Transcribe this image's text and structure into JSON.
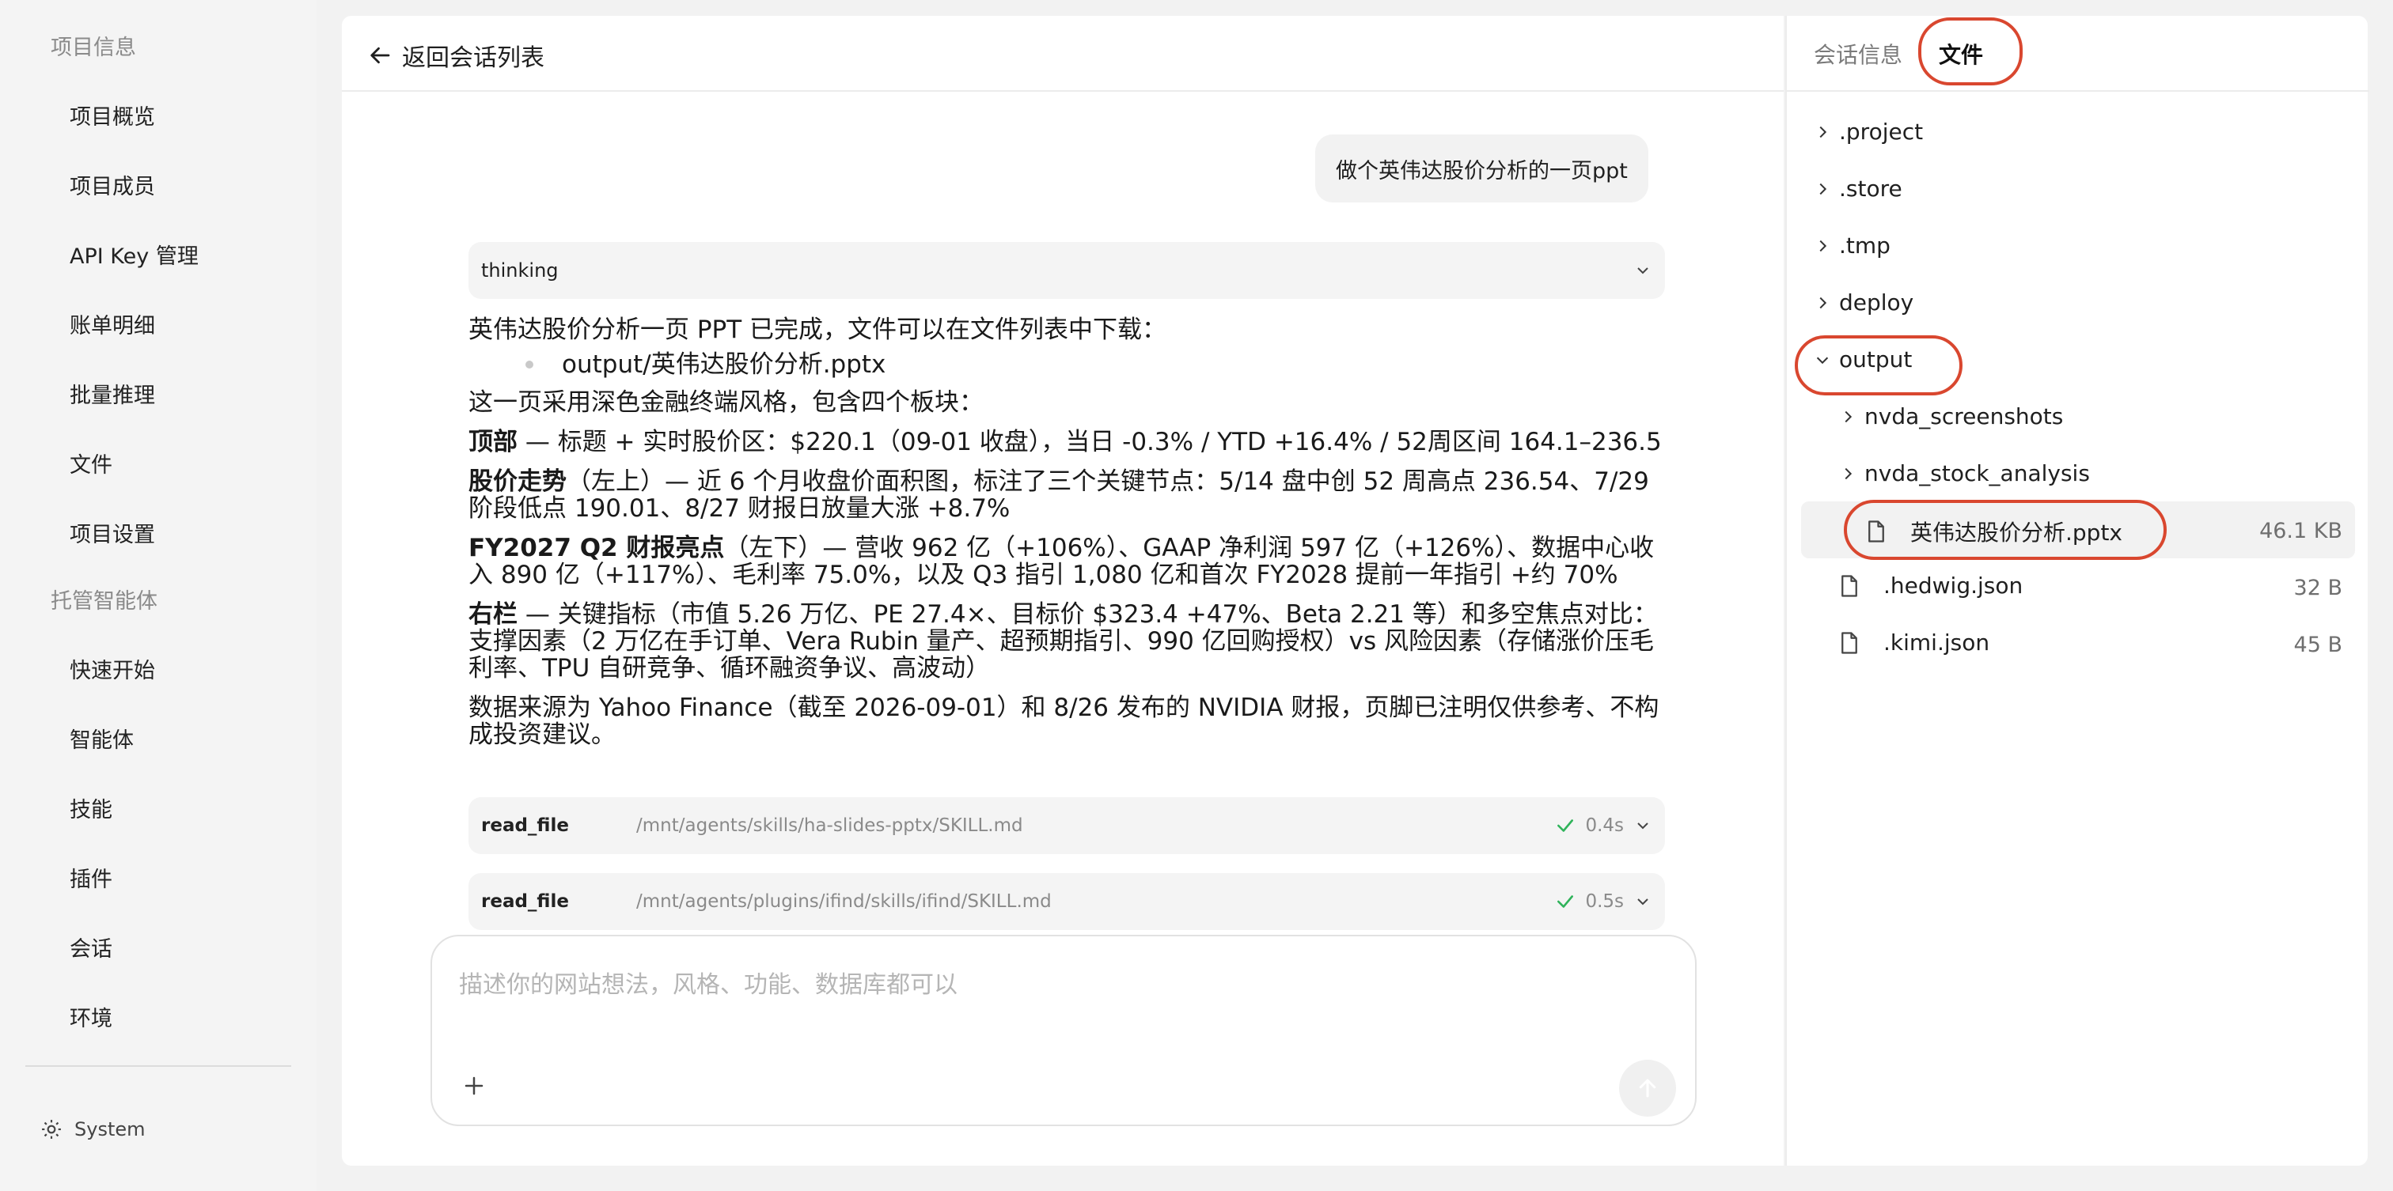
{
  "sidebar": {
    "group_project": "项目信息",
    "project_items": [
      "项目概览",
      "项目成员",
      "API Key 管理",
      "账单明细",
      "批量推理",
      "文件",
      "项目设置"
    ],
    "group_agents": "托管智能体",
    "agent_items": [
      "快速开始",
      "智能体",
      "技能",
      "插件",
      "会话",
      "环境"
    ],
    "system_label": "System"
  },
  "header": {
    "back_label": "返回会话列表"
  },
  "chat": {
    "user_message": "做个英伟达股价分析的一页ppt",
    "thinking_label": "thinking",
    "answer": {
      "intro": "英伟达股价分析一页 PPT 已完成，文件可以在文件列表中下载：",
      "file_bullet": "output/英伟达股价分析.pptx",
      "style_line": "这一页采用深色金融终端风格，包含四个板块：",
      "top_label": "顶部",
      "top_text": " — 标题 + 实时股价区：$220.1（09-01 收盘），当日 -0.3% / YTD +16.4% / 52周区间 164.1–236.5",
      "trend_label": "股价走势",
      "trend_text": "（左上）— 近 6 个月收盘价面积图，标注了三个关键节点：5/14 盘中创 52 周高点 236.54、7/29 阶段低点 190.01、8/27 财报日放量大涨 +8.7%",
      "fy_label": "FY2027 Q2 财报亮点",
      "fy_text": "（左下）— 营收 962 亿（+106%）、GAAP 净利润 597 亿（+126%）、数据中心收入 890 亿（+117%）、毛利率 75.0%，以及 Q3 指引 1,080 亿和首次 FY2028 提前一年指引 +约 70%",
      "right_label": "右栏",
      "right_text": " — 关键指标（市值 5.26 万亿、PE 27.4×、目标价 $323.4 +47%、Beta 2.21 等）和多空焦点对比：支撑因素（2 万亿在手订单、Vera Rubin 量产、超预期指引、990 亿回购授权）vs 风险因素（存储涨价压毛利率、TPU 自研竞争、循环融资争议、高波动）",
      "source_text": "数据来源为 Yahoo Finance（截至 2026-09-01）和 8/26 发布的 NVIDIA 财报，页脚已注明仅供参考、不构成投资建议。"
    },
    "tools": [
      {
        "name": "read_file",
        "path": "/mnt/agents/skills/ha-slides-pptx/SKILL.md",
        "time": "0.4s"
      },
      {
        "name": "read_file",
        "path": "/mnt/agents/plugins/ifind/skills/ifind/SKILL.md",
        "time": "0.5s"
      }
    ],
    "composer_placeholder": "描述你的网站想法，风格、功能、数据库都可以"
  },
  "right_panel": {
    "tabs": [
      "会话信息",
      "文件"
    ],
    "active_tab": "文件",
    "tree": [
      {
        "label": ".project",
        "type": "folder",
        "expanded": false
      },
      {
        "label": ".store",
        "type": "folder",
        "expanded": false
      },
      {
        "label": ".tmp",
        "type": "folder",
        "expanded": false
      },
      {
        "label": "deploy",
        "type": "folder",
        "expanded": false
      },
      {
        "label": "output",
        "type": "folder",
        "expanded": true
      },
      {
        "label": "nvda_screenshots",
        "type": "folder",
        "expanded": false
      },
      {
        "label": "nvda_stock_analysis",
        "type": "folder",
        "expanded": false
      },
      {
        "label": "英伟达股价分析.pptx",
        "type": "file",
        "size": "46.1 KB",
        "selected": true
      },
      {
        "label": ".hedwig.json",
        "type": "file",
        "size": "32 B"
      },
      {
        "label": ".kimi.json",
        "type": "file",
        "size": "45 B"
      }
    ]
  },
  "colors": {
    "annotation_ring": "#d9472f",
    "check_green": "#2fb35a"
  }
}
